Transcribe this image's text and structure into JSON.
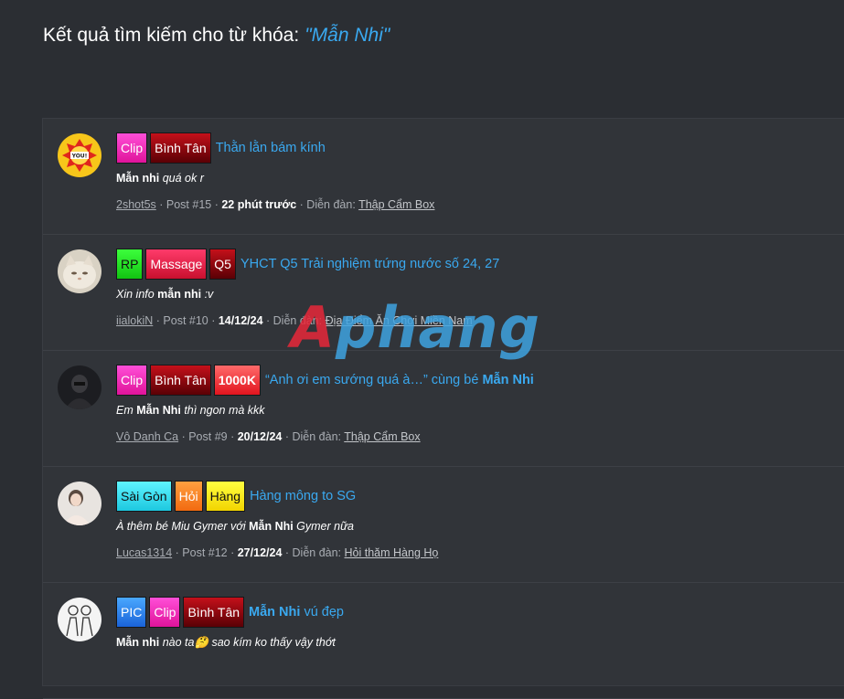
{
  "page": {
    "title": "Kết quả tìm kiếm cho từ khóa:",
    "keyword": "\"Mẫn Nhi\""
  },
  "watermark": {
    "part1": "A",
    "part2": "phang"
  },
  "results": [
    {
      "avatar": "avatar-fuck-you-emoji",
      "tags": [
        {
          "label": "Clip",
          "bg": "linear-gradient(180deg,#ff4fd8,#e0139a)",
          "color": "#ffffff"
        },
        {
          "label": "Bình Tân",
          "bg": "linear-gradient(180deg,#c4101a,#5a0005)",
          "color": "#ffffff"
        }
      ],
      "title_pre": "Thằn lằn bám kính",
      "title_bold": "",
      "title_post": "",
      "snippet_bold": "Mẫn nhi",
      "snippet_text": " quá ok r",
      "snippet_pre": "",
      "snippet_post": "",
      "user": "2shot5s",
      "post": "Post #15",
      "date": "22 phút trước",
      "forum_label": "Diễn đàn:",
      "forum": "Thập Cẩm Box"
    },
    {
      "avatar": "avatar-cat",
      "tags": [
        {
          "label": "RP",
          "bg": "linear-gradient(180deg,#3cff3c,#12c412)",
          "color": "#111111"
        },
        {
          "label": "Massage",
          "bg": "linear-gradient(180deg,#ff3b6b,#c8102e)",
          "color": "#ffffff"
        },
        {
          "label": "Q5",
          "bg": "linear-gradient(180deg,#c4101a,#5a0005)",
          "color": "#ffffff"
        }
      ],
      "title_pre": "YHCT Q5 Trải nghiệm trứng nước số 24, 27",
      "title_bold": "",
      "title_post": "",
      "snippet_pre": "Xin info ",
      "snippet_bold": "mẫn nhi",
      "snippet_post": " :v",
      "user": "iialokiN",
      "post": "Post #10",
      "date": "14/12/24",
      "forum_label": "Diễn đàn:",
      "forum": "Địa Điểm Ăn Chơi Miền Nam"
    },
    {
      "avatar": "avatar-masked-man",
      "tags": [
        {
          "label": "Clip",
          "bg": "linear-gradient(180deg,#ff4fd8,#e0139a)",
          "color": "#ffffff"
        },
        {
          "label": "Bình Tân",
          "bg": "linear-gradient(180deg,#c4101a,#5a0005)",
          "color": "#ffffff"
        },
        {
          "label": "1000K",
          "bg": "linear-gradient(180deg,#ff6a6a,#e2141e)",
          "color": "#ffffff"
        }
      ],
      "title_pre": "“Anh ơi em sướng quá à…” cùng bé ",
      "title_bold": "Mẫn Nhi",
      "title_post": "",
      "snippet_pre": "Em ",
      "snippet_bold": "Mẫn Nhi",
      "snippet_post": " thì ngon mà kkk",
      "user": "Vô Danh Ca",
      "post": "Post #9",
      "date": "20/12/24",
      "forum_label": "Diễn đàn:",
      "forum": "Thập Cẩm Box"
    },
    {
      "avatar": "avatar-woman",
      "tags": [
        {
          "label": "Sài Gòn",
          "bg": "linear-gradient(180deg,#5ff5ff,#1dc8e0)",
          "color": "#111111"
        },
        {
          "label": "Hỏi",
          "bg": "linear-gradient(180deg,#ffa040,#f26a10)",
          "color": "#ffffff"
        },
        {
          "label": "Hàng",
          "bg": "linear-gradient(180deg,#ffff40,#f2d400)",
          "color": "#111111"
        }
      ],
      "title_pre": "Hàng mông to SG",
      "title_bold": "",
      "title_post": "",
      "snippet_pre": "À thêm bé Miu Gymer với ",
      "snippet_bold": "Mẫn Nhi",
      "snippet_post": " Gymer nữa",
      "user": "Lucas1314",
      "post": "Post #12",
      "date": "27/12/24",
      "forum_label": "Diễn đàn:",
      "forum": "Hỏi thăm Hàng Họ"
    },
    {
      "avatar": "avatar-couple-sketch",
      "tags": [
        {
          "label": "PIC",
          "bg": "linear-gradient(180deg,#4aa8ff,#1a63d8)",
          "color": "#ffffff"
        },
        {
          "label": "Clip",
          "bg": "linear-gradient(180deg,#ff4fd8,#e0139a)",
          "color": "#ffffff"
        },
        {
          "label": "Bình Tân",
          "bg": "linear-gradient(180deg,#c4101a,#5a0005)",
          "color": "#ffffff"
        }
      ],
      "title_pre": "",
      "title_bold": "Mẫn Nhi",
      "title_post": " vú đẹp",
      "snippet_pre": "",
      "snippet_bold": "Mẫn nhi",
      "snippet_post": " nào ta🤔 sao kím ko thấy vậy thớt",
      "user": "",
      "post": "",
      "date": "",
      "forum_label": "",
      "forum": ""
    }
  ]
}
